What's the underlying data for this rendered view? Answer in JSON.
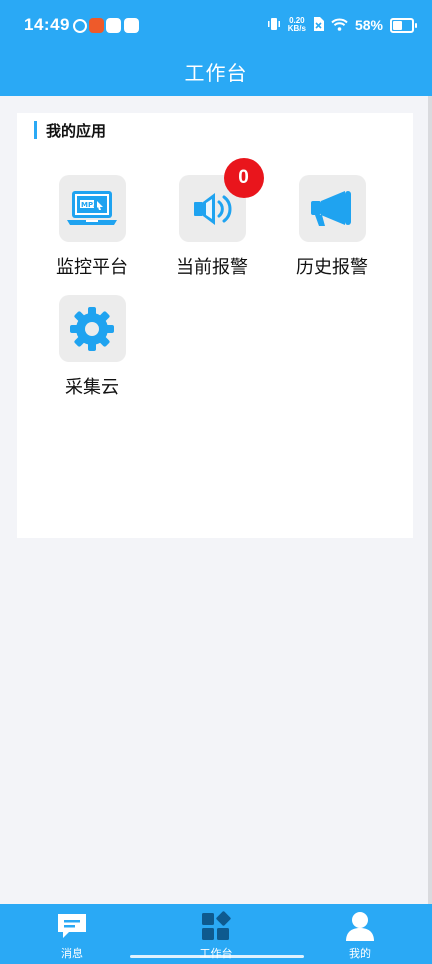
{
  "status_bar": {
    "time": "14:49",
    "net_speed_value": "0.20",
    "net_speed_unit": "KB/s",
    "battery_percent": "58%",
    "battery_level": 0.58
  },
  "header": {
    "title": "工作台"
  },
  "section": {
    "title": "我的应用"
  },
  "apps": [
    {
      "label": "监控平台",
      "icon": "mp3-laptop-icon"
    },
    {
      "label": "当前报警",
      "icon": "speaker-icon",
      "badge": "0"
    },
    {
      "label": "历史报警",
      "icon": "megaphone-icon"
    },
    {
      "label": "采集云",
      "icon": "gear-icon"
    }
  ],
  "bottom_nav": {
    "items": [
      {
        "label": "消息",
        "icon": "message-icon"
      },
      {
        "label": "工作台",
        "icon": "dashboard-icon"
      },
      {
        "label": "我的",
        "icon": "user-icon"
      }
    ]
  },
  "colors": {
    "primary": "#2aa9f5",
    "icon_blue": "#1fa3f0",
    "badge_red": "#e9151c",
    "nav_icon_dark": "#0e5a8f"
  }
}
